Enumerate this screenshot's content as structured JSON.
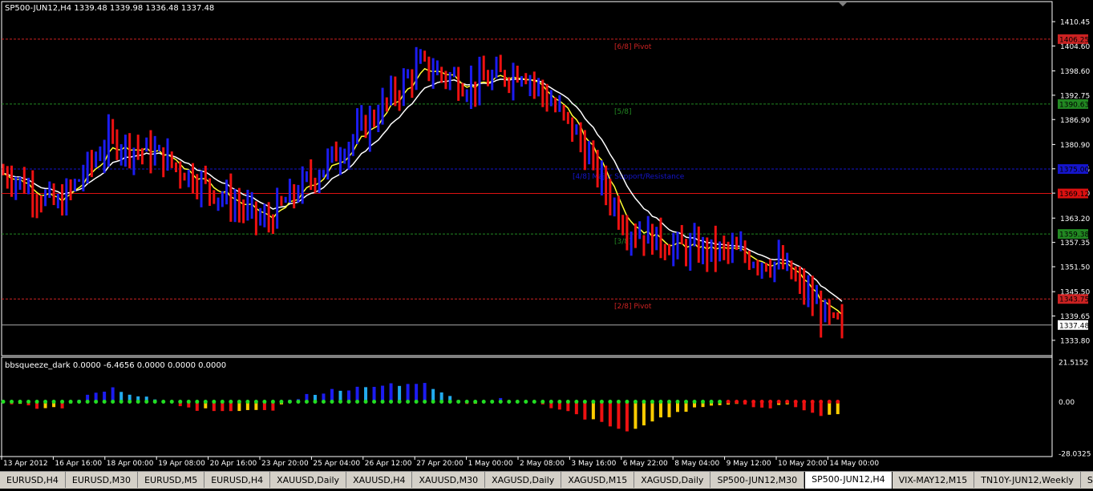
{
  "main_chart": {
    "header": "SP500-JUN12,H4  1339.48 1339.98 1336.48 1337.48",
    "price_scale": [
      "1410.45",
      "1404.60",
      "1398.60",
      "1392.75",
      "1386.90",
      "1380.90",
      "1375.05",
      "1369.20",
      "1363.20",
      "1357.35",
      "1351.50",
      "1345.50",
      "1339.65",
      "1333.80"
    ],
    "price_range": [
      1330.5,
      1414.5
    ],
    "levels": [
      {
        "price": 1406.25,
        "label": "[6/8] Pivot",
        "tag": "1406.25",
        "color": "#cc2222",
        "style": "dashed"
      },
      {
        "price": 1390.63,
        "label": "[5/8]",
        "tag": "1390.63",
        "color": "#228822",
        "style": "dashed"
      },
      {
        "price": 1375.0,
        "label": "[4/8] Major Support/Resistance",
        "tag": "1375.00",
        "color": "#1515cc",
        "style": "dashed"
      },
      {
        "price": 1369.12,
        "label": "",
        "tag": "1369.12",
        "color": "#dd1111",
        "style": "solid"
      },
      {
        "price": 1359.38,
        "label": "[3/8]",
        "tag": "1359.38",
        "color": "#228822",
        "style": "dashed"
      },
      {
        "price": 1343.75,
        "label": "[2/8] Pivot",
        "tag": "1343.75",
        "color": "#cc2222",
        "style": "dashed"
      }
    ],
    "current_price": "1337.48",
    "colors": {
      "up": "#1c1cf0",
      "down": "#ee1111",
      "fast_ma": "#ffff33",
      "slow_ma": "#ffffff"
    }
  },
  "indicator": {
    "header": "bbsqueeze_dark 0.0000 -6.4656 0.0000 0.0000 0.0000",
    "scale": [
      "21.5152",
      "0.00",
      "-28.0325"
    ],
    "range": [
      -28.0325,
      21.5152
    ]
  },
  "time_axis": [
    "13 Apr 2012",
    "16 Apr 16:00",
    "18 Apr 00:00",
    "19 Apr 08:00",
    "20 Apr 16:00",
    "23 Apr 20:00",
    "25 Apr 04:00",
    "26 Apr 12:00",
    "27 Apr 20:00",
    "1 May 00:00",
    "2 May 08:00",
    "3 May 16:00",
    "6 May 22:00",
    "8 May 04:00",
    "9 May 12:00",
    "10 May 20:00",
    "14 May 00:00"
  ],
  "tabs": [
    "EURUSD,H4",
    "EURUSD,M30",
    "EURUSD,M5",
    "EURUSD,H4",
    "XAUUSD,Daily",
    "XAUUSD,H4",
    "XAUUSD,M30",
    "XAGUSD,Daily",
    "XAGUSD,M15",
    "XAGUSD,Daily",
    "SP500-JUN12,M30",
    "SP500-JUN12,H4",
    "VIX-MAY12,M15",
    "TN10Y-JUN12,Weekly",
    "SIE"
  ],
  "active_tab": 11,
  "chart_data": {
    "type": "bar",
    "title": "SP500-JUN12,H4",
    "x": [
      "13 Apr 2012",
      "16 Apr 16:00",
      "18 Apr 00:00",
      "19 Apr 08:00",
      "20 Apr 16:00",
      "23 Apr 20:00",
      "25 Apr 04:00",
      "26 Apr 12:00",
      "27 Apr 20:00",
      "1 May 00:00",
      "2 May 08:00",
      "3 May 16:00",
      "6 May 22:00",
      "8 May 04:00",
      "9 May 12:00",
      "10 May 20:00",
      "14 May 00:00"
    ],
    "closes": [
      1374,
      1366,
      1382,
      1378,
      1370,
      1362,
      1374,
      1386,
      1400,
      1395,
      1399,
      1384,
      1361,
      1356,
      1355,
      1352,
      1337.48
    ],
    "ohlc_last": {
      "open": 1339.48,
      "high": 1339.98,
      "low": 1336.48,
      "close": 1337.48
    }
  }
}
